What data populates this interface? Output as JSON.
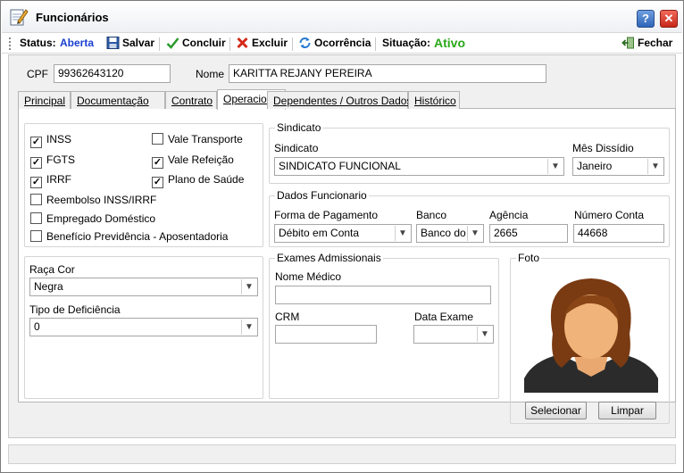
{
  "window": {
    "title": "Funcionários",
    "help_label": "?",
    "close_label": "✕"
  },
  "toolbar": {
    "status_label": "Status:",
    "status_value": "Aberta",
    "save_label": "Salvar",
    "conclude_label": "Concluir",
    "delete_label": "Excluir",
    "occurrence_label": "Ocorrência",
    "situation_label": "Situação:",
    "situation_value": "Ativo",
    "close_label": "Fechar"
  },
  "header": {
    "cpf_label": "CPF",
    "cpf_value": "99362643120",
    "name_label": "Nome",
    "name_value": "KARITTA REJANY PEREIRA"
  },
  "tabs": [
    "Principal",
    "Documentação",
    "Contrato",
    "Operacional",
    "Dependentes / Outros Dados",
    "Histórico"
  ],
  "benefits": {
    "inss": "INSS",
    "fgts": "FGTS",
    "irrf": "IRRF",
    "vale_transporte": "Vale Transporte",
    "vale_refeicao": "Vale Refeição",
    "plano_saude": "Plano de Saúde",
    "reembolso": "Reembolso INSS/IRRF",
    "empregado_domestico": "Empregado Doméstico",
    "beneficio": "Benefício Previdência - Aposentadoria"
  },
  "sindicato": {
    "group_title": "Sindicato",
    "label": "Sindicato",
    "value": "SINDICATO FUNCIONAL",
    "dissidio_label": "Mês Dissídio",
    "dissidio_value": "Janeiro"
  },
  "dados": {
    "group_title": "Dados Funcionario",
    "forma_label": "Forma de Pagamento",
    "forma_value": "Débito em Conta",
    "banco_label": "Banco",
    "banco_value": "Banco do B",
    "agencia_label": "Agência",
    "agencia_value": "2665",
    "conta_label": "Número Conta",
    "conta_value": "44668"
  },
  "raca": {
    "label": "Raça Cor",
    "value": "Negra"
  },
  "deficiencia": {
    "label": "Tipo de Deficiência",
    "value": "0"
  },
  "exames": {
    "group_title": "Exames Admissionais",
    "medico_label": "Nome Médico",
    "crm_label": "CRM",
    "data_label": "Data Exame"
  },
  "foto": {
    "group_title": "Foto",
    "select_label": "Selecionar",
    "clear_label": "Limpar"
  }
}
